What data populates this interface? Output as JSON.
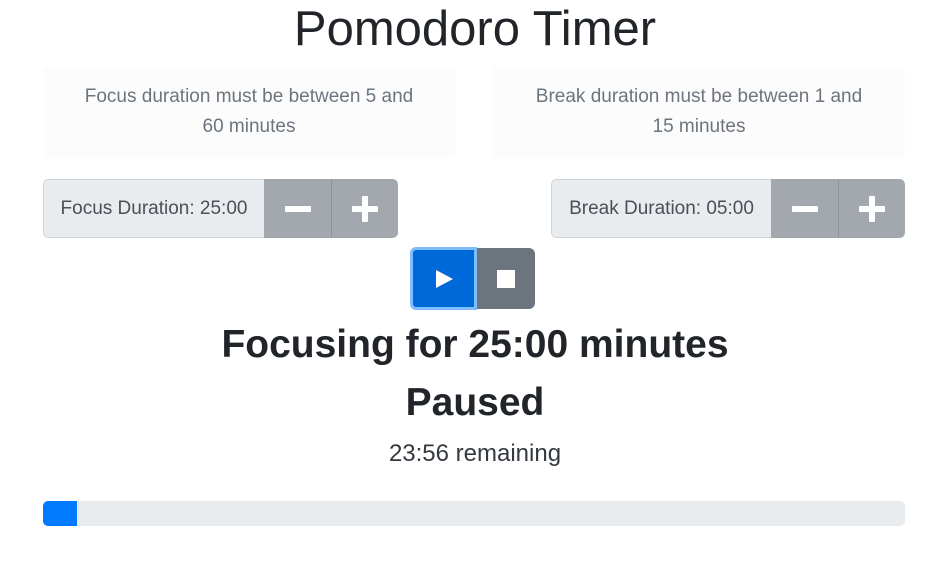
{
  "title": "Pomodoro Timer",
  "notes": {
    "focus": "Focus duration must be between 5 and 60 minutes",
    "break": "Break duration must be between 1 and 15 minutes"
  },
  "focus_duration": {
    "label": "Focus Duration: 25:00",
    "decrement_icon": "minus-icon",
    "increment_icon": "plus-icon"
  },
  "break_duration": {
    "label": "Break Duration: 05:00",
    "decrement_icon": "minus-icon",
    "increment_icon": "plus-icon"
  },
  "controls": {
    "play_icon": "play-icon",
    "stop_icon": "stop-icon"
  },
  "status": {
    "mode_text": "Focusing for 25:00 minutes",
    "state_text": "Paused",
    "remaining_text": "23:56 remaining"
  },
  "progress": {
    "fraction": 0.04
  },
  "colors": {
    "primary": "#007bff",
    "active_play": "#0069d9",
    "secondary": "#6c757d",
    "stepper": "#a3a8ae",
    "track": "#e9ecef"
  }
}
